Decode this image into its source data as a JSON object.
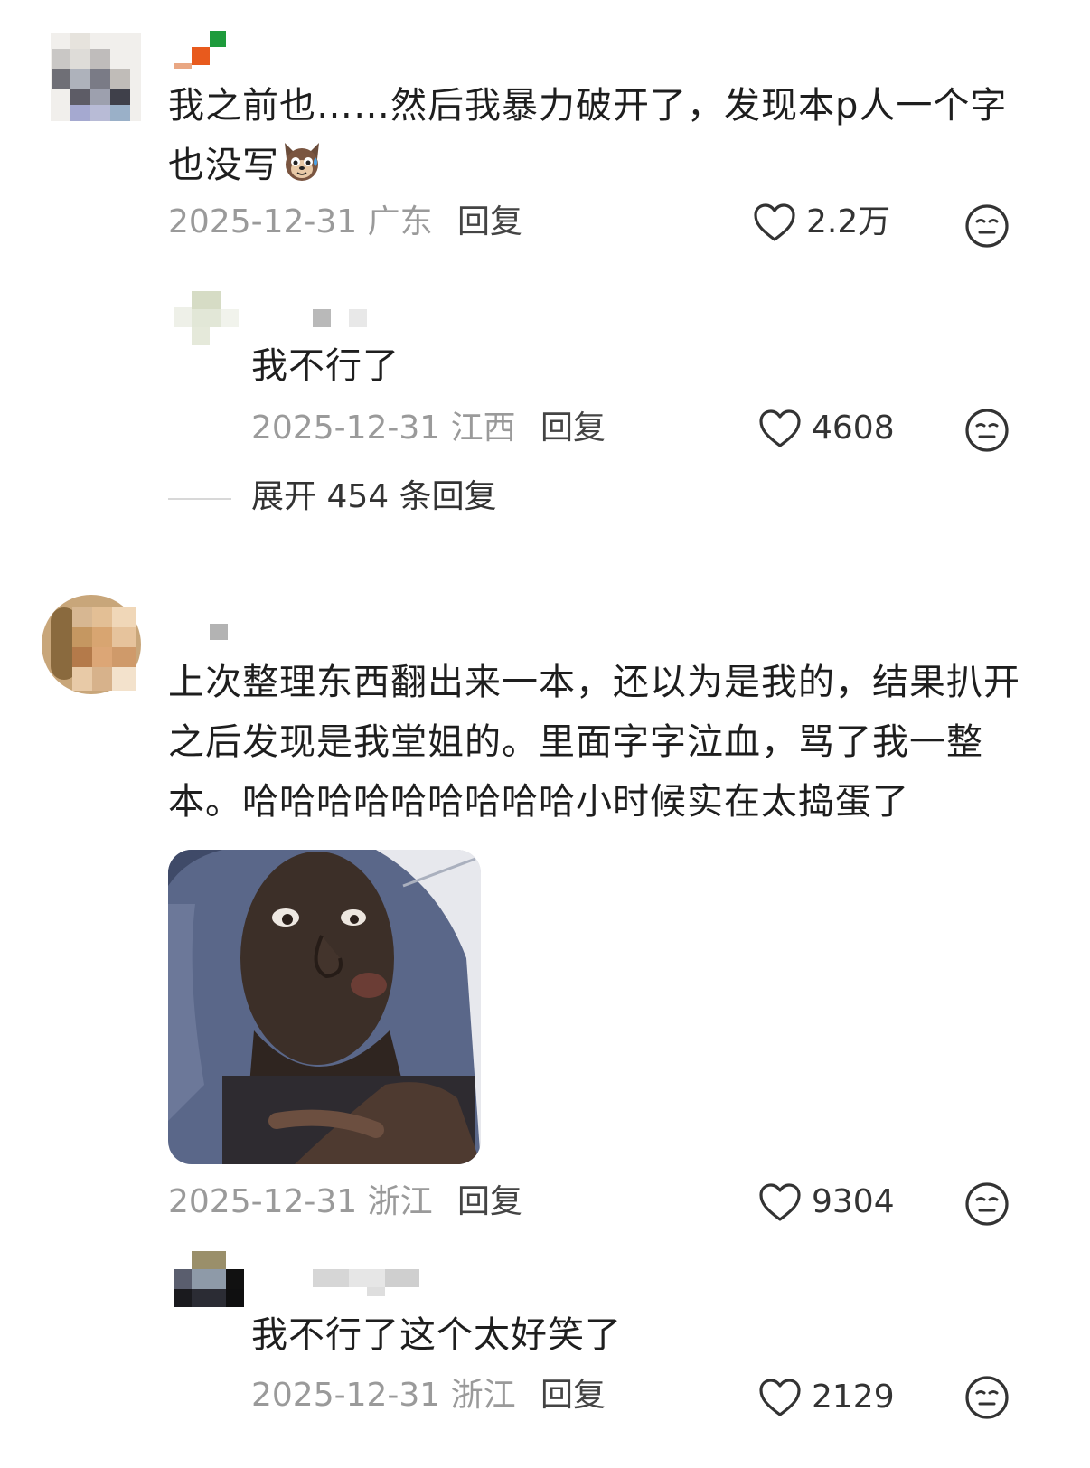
{
  "comments": [
    {
      "text_line1": "我之前也……然后我暴力破开了，发现本p人一个字",
      "text_line2": "也没写",
      "emoji": "dog-face-sweat-emoji",
      "date": "2025-12-31",
      "region": "广东",
      "reply_label": "回复",
      "likes": "2.2万",
      "replies": [
        {
          "text": "我不行了",
          "date": "2025-12-31",
          "region": "江西",
          "reply_label": "回复",
          "likes": "4608"
        }
      ],
      "expand_label": "展开 454 条回复"
    },
    {
      "text_line1": "上次整理东西翻出来一本，还以为是我的，结果扒开",
      "text_line2": "之后发现是我堂姐的。里面字字泣血，骂了我一整",
      "text_line3": "本。哈哈哈哈哈哈哈哈哈小时候实在太捣蛋了",
      "image": "reaction-meme-photo",
      "date": "2025-12-31",
      "region": "浙江",
      "reply_label": "回复",
      "likes": "9304",
      "replies": [
        {
          "text": "我不行了这个太好笑了",
          "date": "2025-12-31",
          "region": "浙江",
          "reply_label": "回复",
          "likes": "2129"
        }
      ]
    }
  ],
  "icons": {
    "like": "heart-outline-icon",
    "dislike": "neutral-face-icon"
  },
  "colors": {
    "meta_gray": "#9a9a9a",
    "text": "#1e1e1e",
    "icon": "#333333"
  }
}
